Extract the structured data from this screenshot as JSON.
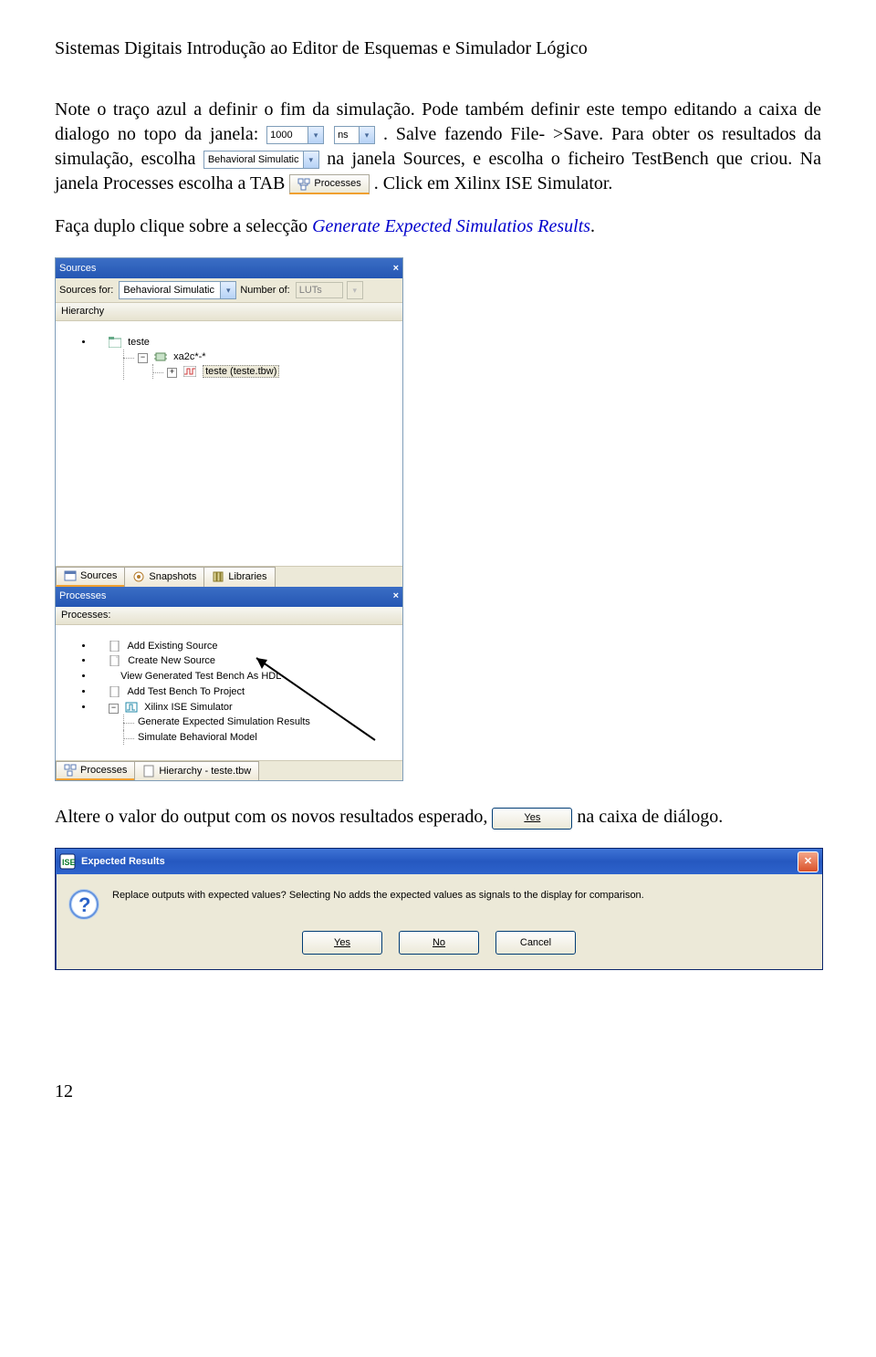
{
  "header": "Sistemas Digitais Introdução ao Editor de Esquemas e Simulador Lógico",
  "para1a": "Note o traço azul a definir o fim da simulação. Pode também definir este tempo editando a caixa de dialogo no topo da janela: ",
  "combo_time": {
    "value": "1000",
    "unit": "ns"
  },
  "para1b": ". Salve fazendo File- >Save. Para obter os resultados da simulação, escolha ",
  "dd_behav": "Behavioral Simulatic",
  "para1c": " na janela Sources, e escolha o ficheiro TestBench que criou. Na janela Processes escolha a TAB ",
  "tab_processes": "Processes",
  "para1d": ". Click em Xilinx ISE Simulator.",
  "para2a": "Faça duplo clique sobre a selecção ",
  "para2b": "Generate Expected Simulatios Results",
  "para2c": ".",
  "sources_panel": {
    "title": "Sources",
    "sources_for_lbl": "Sources for:",
    "sources_for_val": "Behavioral Simulatic",
    "number_of_lbl": "Number of:",
    "number_of_val": "LUTs",
    "hierarchy_lbl": "Hierarchy",
    "tree": {
      "root": "teste",
      "chip": "xa2c*-*",
      "file": "teste (teste.tbw)"
    },
    "tabs": [
      "Sources",
      "Snapshots",
      "Libraries"
    ]
  },
  "processes_panel": {
    "title": "Processes",
    "processes_lbl": "Processes:",
    "items": [
      "Add Existing Source",
      "Create New Source",
      "View Generated Test Bench As HDL",
      "Add Test Bench To Project",
      "Xilinx ISE Simulator",
      "Generate Expected Simulation Results",
      "Simulate Behavioral Model"
    ],
    "tabs": [
      "Processes",
      "Hierarchy - teste.tbw"
    ]
  },
  "para3a": "Altere o valor do output com os novos resultados esperado, ",
  "yes_btn": "Yes",
  "para3b": " na caixa de diálogo.",
  "dialog": {
    "title": "Expected Results",
    "msg": "Replace outputs with expected values?  Selecting No adds the expected values as signals to the display for comparison.",
    "yes": "Yes",
    "no": "No",
    "cancel": "Cancel"
  },
  "page_number": "12"
}
